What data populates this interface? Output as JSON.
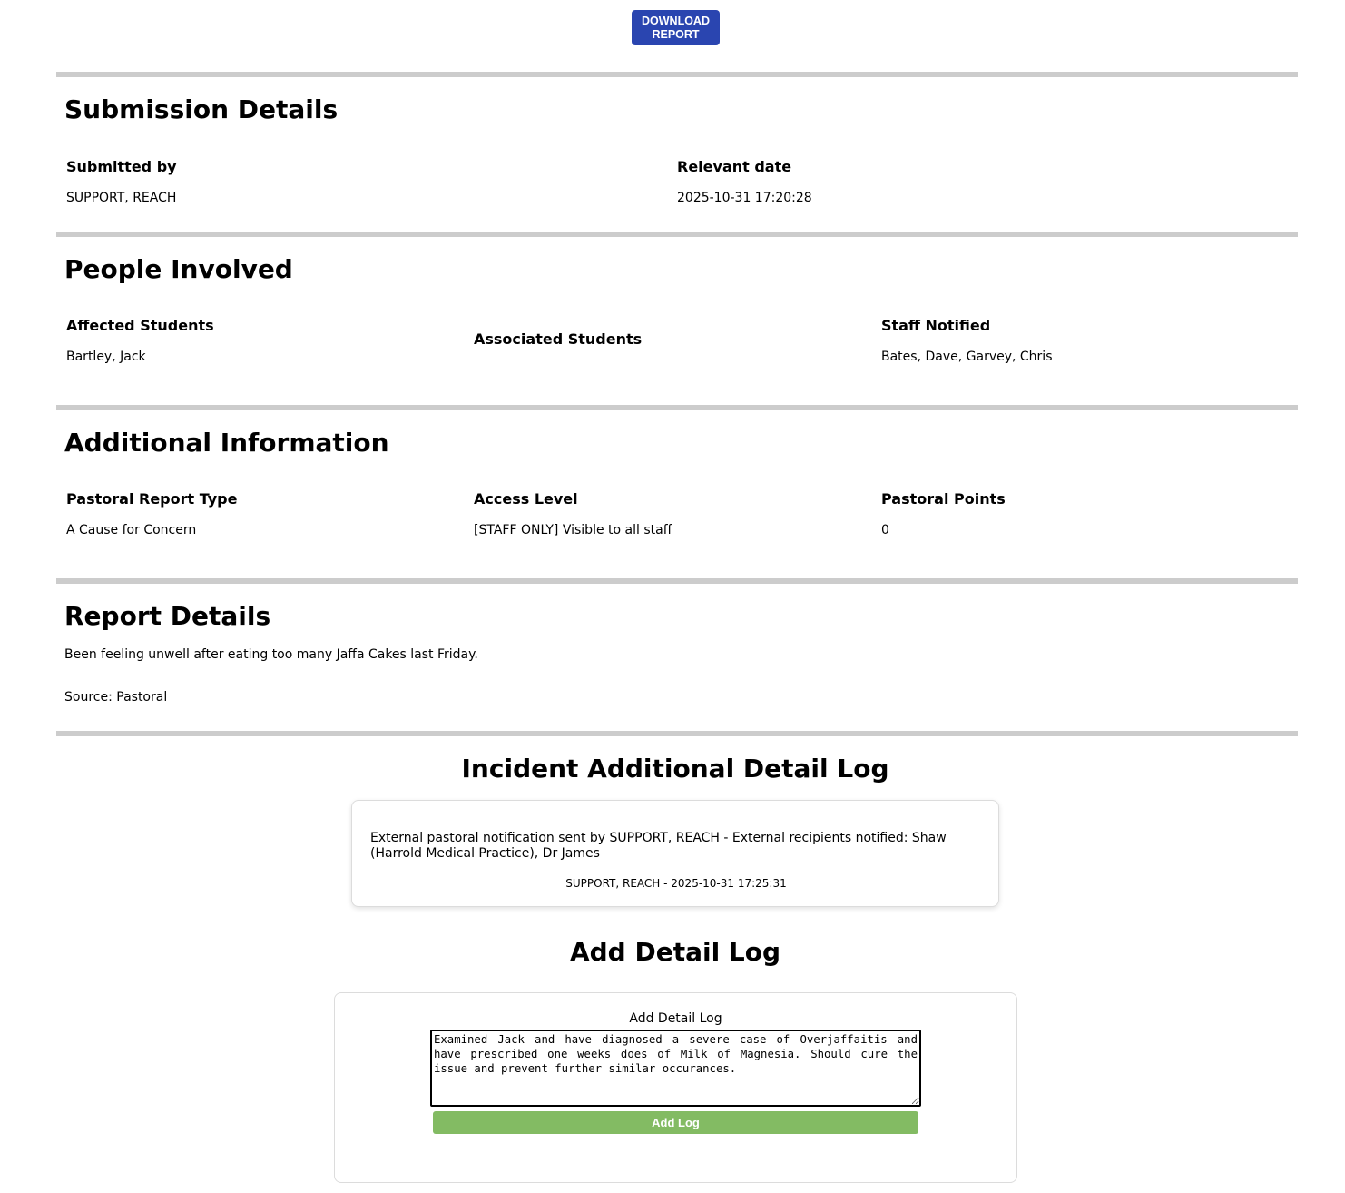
{
  "toolbar": {
    "download_line1": "DOWNLOAD",
    "download_line2": "REPORT"
  },
  "submission": {
    "title": "Submission Details",
    "submitted_by_label": "Submitted by",
    "submitted_by_value": "SUPPORT, REACH",
    "relevant_date_label": "Relevant date",
    "relevant_date_value": "2025-10-31 17:20:28"
  },
  "people": {
    "title": "People Involved",
    "affected_label": "Affected Students",
    "affected_value": "Bartley, Jack",
    "associated_label": "Associated Students",
    "associated_value": "",
    "staff_label": "Staff Notified",
    "staff_value": "Bates, Dave, Garvey, Chris"
  },
  "additional": {
    "title": "Additional Information",
    "report_type_label": "Pastoral Report Type",
    "report_type_value": "A Cause for Concern",
    "access_label": "Access Level",
    "access_value": "[STAFF ONLY] Visible to all staff",
    "points_label": "Pastoral Points",
    "points_value": "0"
  },
  "report": {
    "title": "Report Details",
    "description": "Been feeling unwell after eating too many Jaffa Cakes last Friday.",
    "source": "Source: Pastoral"
  },
  "detail_log": {
    "title": "Incident Additional Detail Log",
    "entries": [
      {
        "text": "External pastoral notification sent by SUPPORT, REACH - External recipients notified: Shaw (Harrold Medical Practice), Dr James",
        "meta": "SUPPORT, REACH - 2025-10-31 17:25:31"
      }
    ]
  },
  "add_log": {
    "title": "Add Detail Log",
    "label": "Add Detail Log",
    "textarea_value": "Examined Jack and have diagnosed a severe case of Overjaffaitis and have prescribed one weeks does of Milk of Magnesia. Should cure the issue and prevent further similar occurances.",
    "button_label": "Add Log"
  }
}
